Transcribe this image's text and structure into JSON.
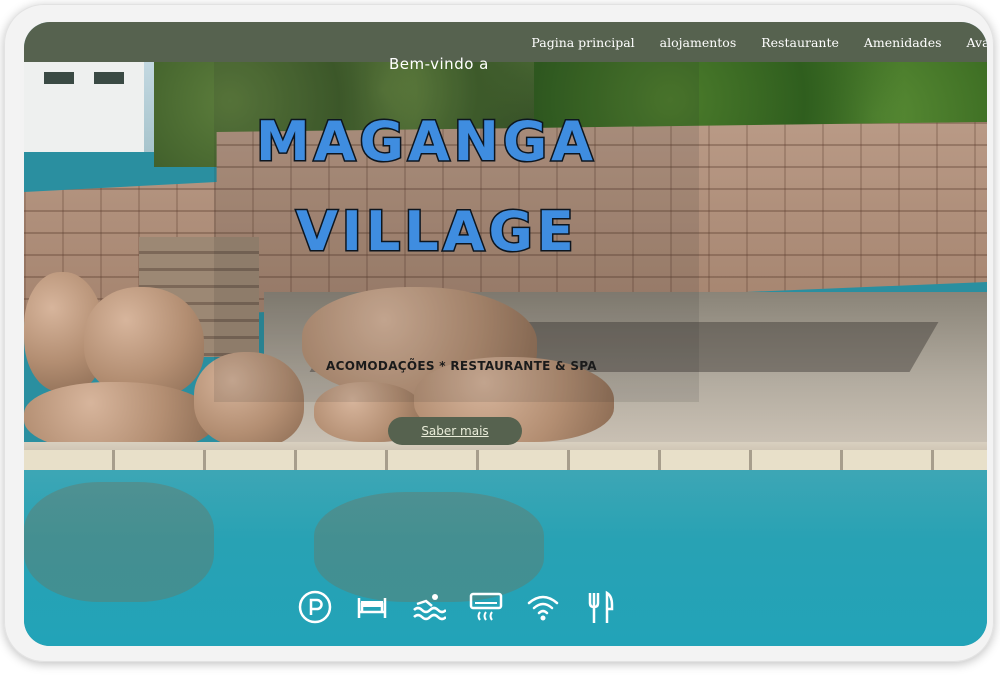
{
  "nav": {
    "links": [
      "Pagina principal",
      "alojamentos",
      "Restaurante",
      "Amenidades",
      "Avaliaç"
    ]
  },
  "hero": {
    "welcome": "Bem-vindo a",
    "title_line1": "MAGANGA",
    "title_line2": "VILLAGE",
    "tagline": "ACOMODAÇÕES  * RESTAURANTE & SPA",
    "cta_label": "Saber mais"
  },
  "amenities": [
    {
      "icon": "parking-icon"
    },
    {
      "icon": "bed-icon"
    },
    {
      "icon": "pool-icon"
    },
    {
      "icon": "air-conditioning-icon"
    },
    {
      "icon": "wifi-icon"
    },
    {
      "icon": "restaurant-icon"
    }
  ],
  "colors": {
    "nav_bg": "#56624f",
    "title_fill": "#3f8de0",
    "pool": "#28a2b4"
  }
}
